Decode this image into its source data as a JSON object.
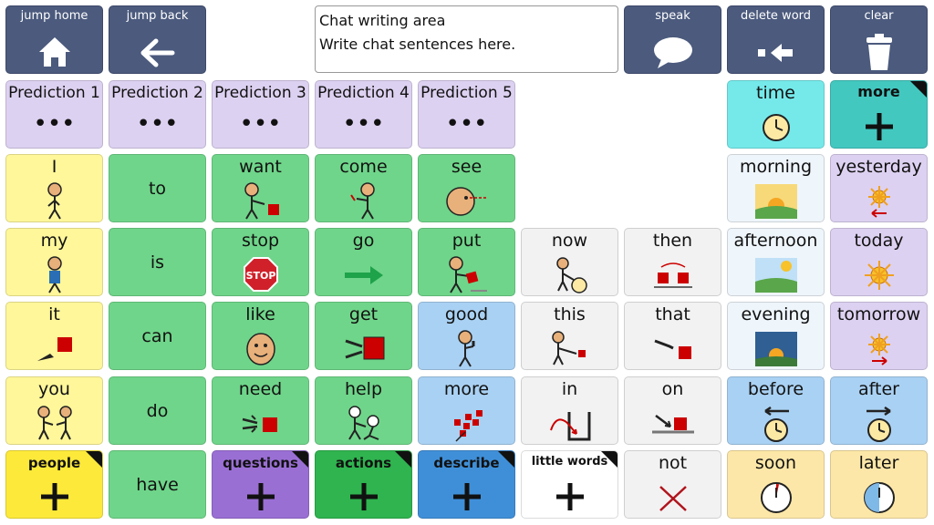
{
  "toolbar": {
    "jump_home": "jump home",
    "jump_back": "jump back",
    "speak": "speak",
    "delete_word": "delete word",
    "clear": "clear"
  },
  "chat": {
    "line1": "Chat writing area",
    "line2": "Write chat sentences here."
  },
  "predictions": [
    {
      "label": "Prediction 1",
      "ellipsis": "•••"
    },
    {
      "label": "Prediction 2",
      "ellipsis": "•••"
    },
    {
      "label": "Prediction 3",
      "ellipsis": "•••"
    },
    {
      "label": "Prediction 4",
      "ellipsis": "•••"
    },
    {
      "label": "Prediction 5",
      "ellipsis": "•••"
    }
  ],
  "words": {
    "time": "time",
    "more_top": "more",
    "i": "I",
    "to": "to",
    "want": "want",
    "come": "come",
    "see": "see",
    "morning": "morning",
    "yesterday": "yesterday",
    "my": "my",
    "is": "is",
    "stop": "stop",
    "go": "go",
    "put": "put",
    "now": "now",
    "then": "then",
    "afternoon": "afternoon",
    "today": "today",
    "it": "it",
    "can": "can",
    "like": "like",
    "get": "get",
    "good": "good",
    "this": "this",
    "that": "that",
    "evening": "evening",
    "tomorrow": "tomorrow",
    "you": "you",
    "do": "do",
    "need": "need",
    "help": "help",
    "more": "more",
    "in": "in",
    "on": "on",
    "before": "before",
    "after": "after",
    "people": "people",
    "have": "have",
    "questions": "questions",
    "actions": "actions",
    "describe": "describe",
    "little_words": "little words",
    "not": "not",
    "soon": "soon",
    "later": "later"
  },
  "stop_sign_text": "STOP",
  "colors": {
    "toolbar": "#4b5a7d",
    "pronoun": "#fff79a",
    "verb": "#6fd58a",
    "adjective": "#a9d1f3",
    "little_word": "#f2f2f2",
    "time": "#ddd1f1",
    "teal": "#43c8c0",
    "cyan": "#75e9ea",
    "peach": "#fde7a8",
    "people_folder": "#fde93a",
    "questions_folder": "#9a6fd4",
    "actions_folder": "#2fb44f",
    "describe_folder": "#3f8fd8"
  }
}
